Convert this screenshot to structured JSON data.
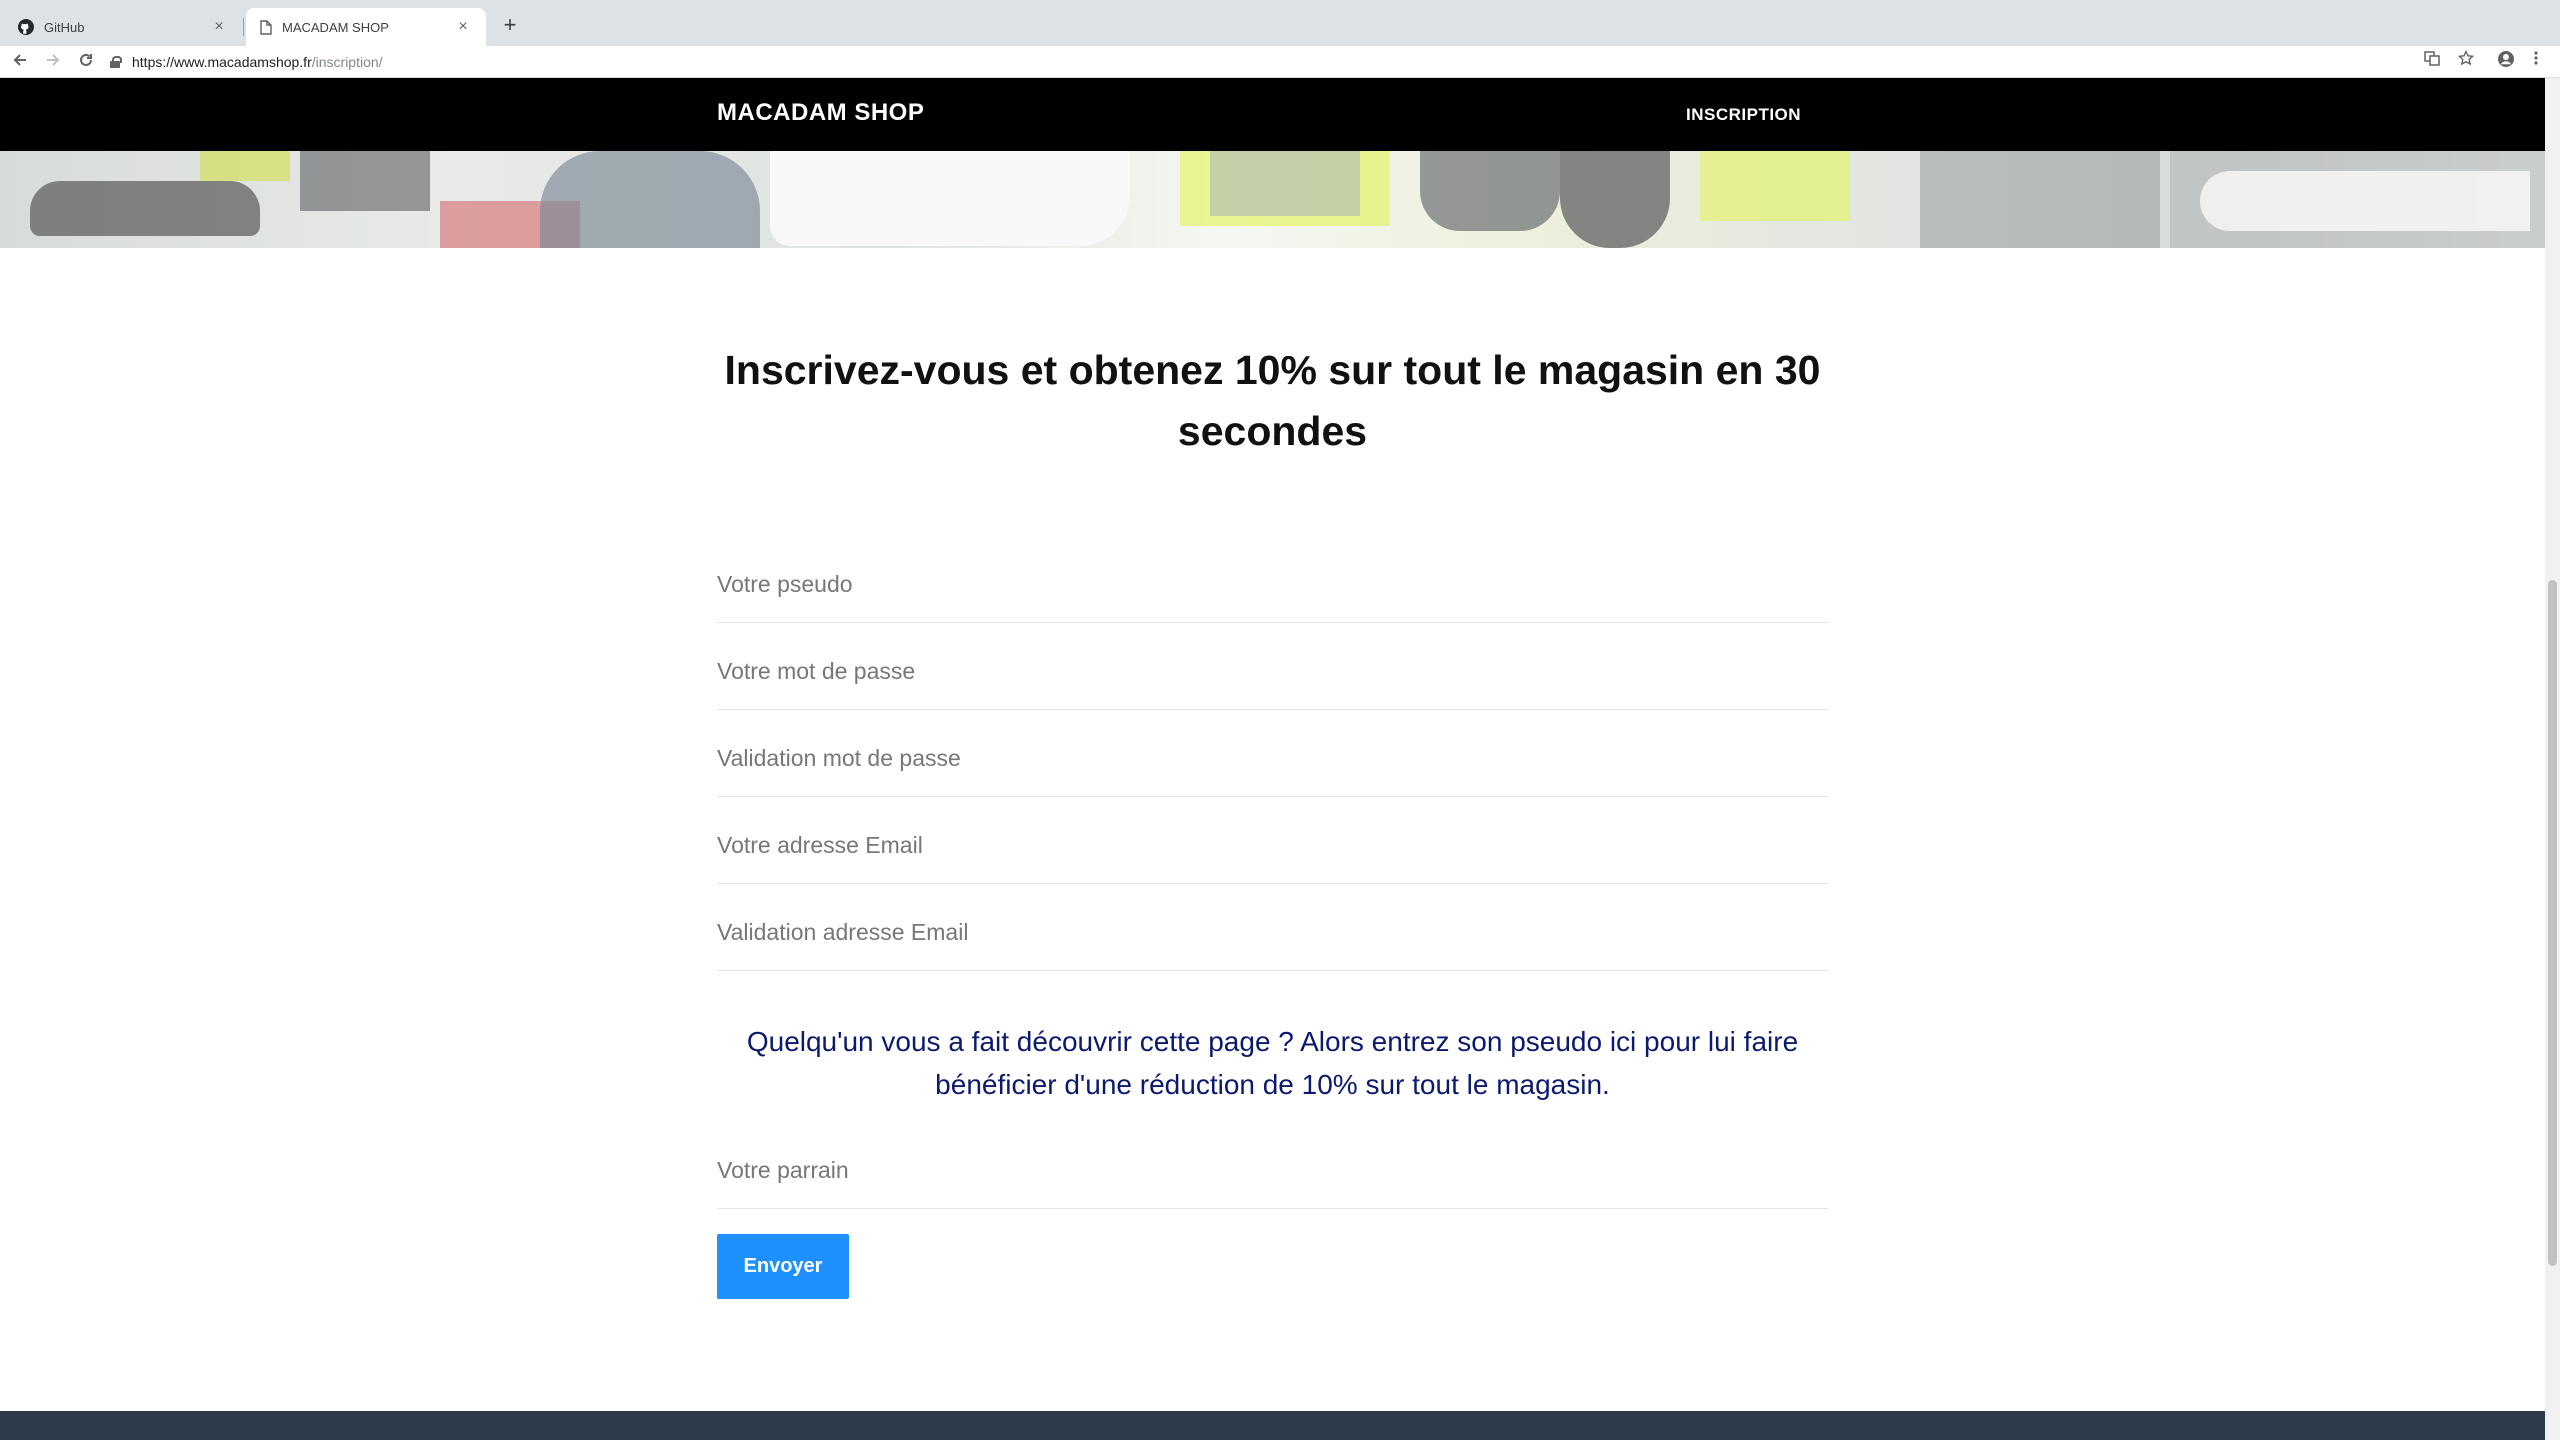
{
  "browser": {
    "tabs": [
      {
        "title": "GitHub",
        "icon": "github-icon",
        "active": false
      },
      {
        "title": "MACADAM SHOP",
        "icon": "page-icon",
        "active": true
      }
    ],
    "close_glyph": "×",
    "new_tab_glyph": "+",
    "url": {
      "host": "https://www.macadamshop.fr",
      "path": "/inscription/"
    }
  },
  "site": {
    "brand": "MACADAM SHOP",
    "nav": {
      "inscription": "INSCRIPTION"
    }
  },
  "form": {
    "heading": "Inscrivez-vous et obtenez 10% sur tout le magasin en 30 secondes",
    "fields": [
      {
        "placeholder": "Votre pseudo",
        "value": ""
      },
      {
        "placeholder": "Votre mot de passe",
        "value": ""
      },
      {
        "placeholder": "Validation mot de passe",
        "value": ""
      },
      {
        "placeholder": "Votre adresse Email",
        "value": ""
      },
      {
        "placeholder": "Validation adresse Email",
        "value": ""
      }
    ],
    "referral_text": "Quelqu'un vous a fait découvrir cette page ? Alors entrez son pseudo ici pour lui faire bénéficier d'une réduction de 10% sur tout le magasin.",
    "referral_field": {
      "placeholder": "Votre parrain",
      "value": ""
    },
    "submit_label": "Envoyer"
  },
  "colors": {
    "header_bg": "#000000",
    "button": "#1e90ff",
    "referral_text": "#0b1a6e",
    "footer": "#2c3a4a"
  }
}
